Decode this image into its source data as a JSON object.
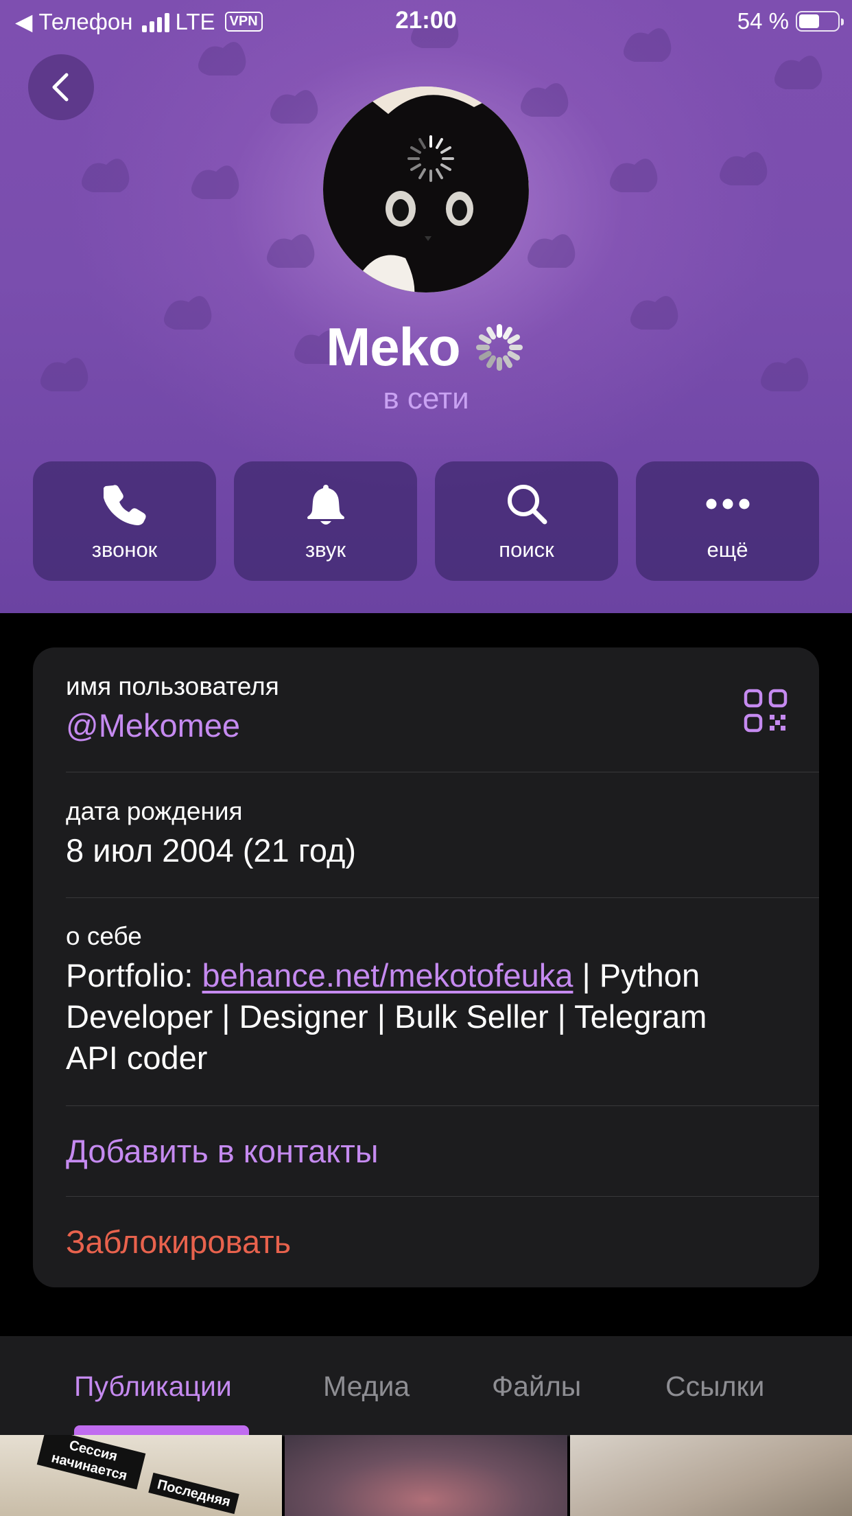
{
  "status_bar": {
    "carrier_back": "◀ Телефон",
    "network": "LTE",
    "vpn": "VPN",
    "time": "21:00",
    "battery": "54 %",
    "battery_level": 0.54
  },
  "profile": {
    "name": "Meko",
    "status": "в сети"
  },
  "actions": [
    {
      "label": "звонок",
      "icon": "phone-icon"
    },
    {
      "label": "звук",
      "icon": "bell-icon"
    },
    {
      "label": "поиск",
      "icon": "search-icon"
    },
    {
      "label": "ещё",
      "icon": "more-icon"
    }
  ],
  "info": {
    "username_label": "имя пользователя",
    "username": "@Mekomee",
    "birthday_label": "дата рождения",
    "birthday": "8 июл 2004 (21 год)",
    "bio_label": "о себе",
    "bio_prefix": "Portfolio: ",
    "bio_link": "behance.net/mekotofeuka",
    "bio_suffix_1": " | Python",
    "bio_line_2": "Developer | Designer | Bulk Seller | Telegram",
    "bio_line_3": "API coder",
    "add_contact": "Добавить в контакты",
    "block": "Заблокировать"
  },
  "tabs": [
    {
      "label": "Публикации",
      "active": true
    },
    {
      "label": "Медиа",
      "active": false
    },
    {
      "label": "Файлы",
      "active": false
    },
    {
      "label": "Ссылки",
      "active": false
    }
  ],
  "thumbnails": {
    "sticker_1": "Сессия начинается",
    "sticker_2": "Последняя"
  },
  "colors": {
    "accent": "#c58af0",
    "danger": "#e8624d",
    "header": "#7a4eae",
    "card": "#1c1c1e"
  }
}
